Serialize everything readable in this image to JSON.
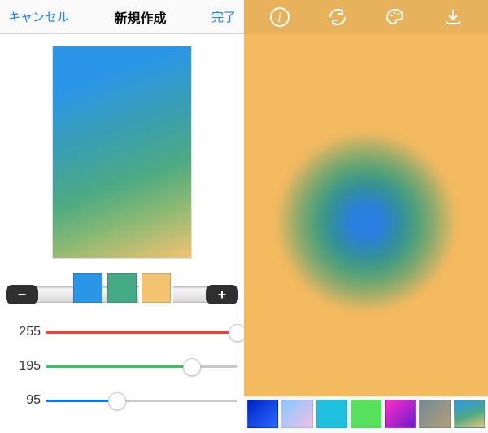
{
  "nav": {
    "cancel": "キャンセル",
    "title": "新規作成",
    "done": "完了"
  },
  "swatches": [
    {
      "color": "#2b96e8",
      "selected": false
    },
    {
      "color": "#45aa86",
      "selected": false
    },
    {
      "color": "#f3c371",
      "selected": true
    }
  ],
  "endButtons": {
    "minus": "−",
    "plus": "+"
  },
  "rgb": {
    "r": 255,
    "g": 195,
    "b": 95
  },
  "toolbar": {
    "info": "info-icon",
    "refresh": "refresh-icon",
    "palette": "palette-icon",
    "download": "download-icon"
  },
  "presets": [
    {
      "gradient": "linear-gradient(135deg,#0023c6,#2a6bff)",
      "selected": false
    },
    {
      "gradient": "linear-gradient(135deg,#82c9ff,#f2bfe6)",
      "selected": false
    },
    {
      "gradient": "linear-gradient(135deg,#1fbfe0,#1fbfe0)",
      "selected": false
    },
    {
      "gradient": "linear-gradient(135deg,#56e05c,#56e05c)",
      "selected": false
    },
    {
      "gradient": "linear-gradient(135deg,#ff2ec4,#6a1bd1)",
      "selected": false
    },
    {
      "gradient": "linear-gradient(135deg,#6f8a98,#b69e77)",
      "selected": false
    },
    {
      "gradient": "linear-gradient(160deg,#2b96e8,#4daa83 55%,#f3c371)",
      "selected": true
    }
  ]
}
